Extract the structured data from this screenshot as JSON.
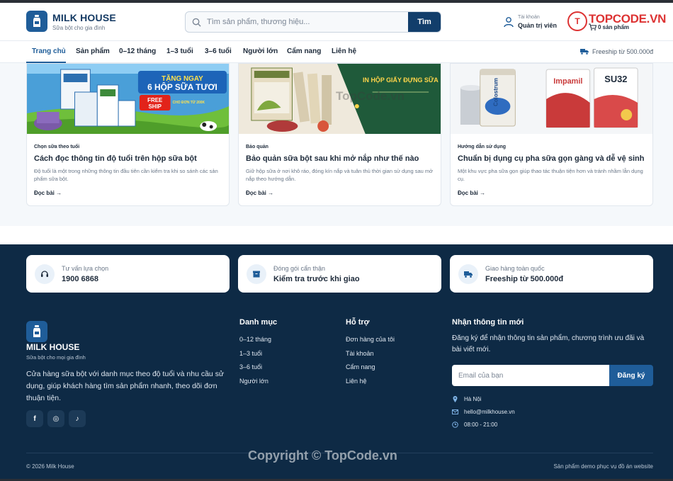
{
  "header": {
    "brand_name": "MILK HOUSE",
    "brand_tagline": "Sữa bột cho gia đình",
    "search_placeholder": "Tìm sản phẩm, thương hiệu...",
    "search_button": "Tìm",
    "account_small": "Tài khoản",
    "account_big": "Quản trị viên",
    "cart_count": "0 sản phẩm",
    "topcode_text": "TOPCODE.VN"
  },
  "nav": {
    "items": [
      {
        "label": "Trang chủ",
        "active": true
      },
      {
        "label": "Sản phẩm"
      },
      {
        "label": "0–12 tháng"
      },
      {
        "label": "1–3 tuổi"
      },
      {
        "label": "3–6 tuổi"
      },
      {
        "label": "Người lớn"
      },
      {
        "label": "Cẩm nang"
      },
      {
        "label": "Liên hệ"
      }
    ],
    "freeship": "Freeship từ 500.000đ"
  },
  "articles": [
    {
      "category": "Chọn sữa theo tuổi",
      "title": "Cách đọc thông tin độ tuổi trên hộp sữa bột",
      "description": "Độ tuổi là một trong những thông tin đầu tiên cần kiểm tra khi so sánh các sản phẩm sữa bột.",
      "link": "Đọc bài →",
      "image_text": {
        "promo1": "TẶNG NGAY",
        "promo2": "6 HỘP SỮA TƯƠI",
        "free1": "FREE",
        "free2": "SHIP",
        "min": "CHO ĐƠN TỪ 200K"
      }
    },
    {
      "category": "Bảo quản",
      "title": "Bảo quản sữa bột sau khi mở nắp như thế nào",
      "description": "Giữ hộp sữa ở nơi khô ráo, đóng kín nắp và tuân thủ thời gian sử dụng sau mở nắp theo hướng dẫn.",
      "link": "Đọc bài →",
      "image_text": {
        "headline": "IN HỘP GIẤY ĐỰNG SỮA"
      }
    },
    {
      "category": "Hướng dẫn sử dụng",
      "title": "Chuẩn bị dụng cụ pha sữa gọn gàng và dễ vệ sinh",
      "description": "Một khu vực pha sữa gọn giúp thao tác thuận tiện hơn và tránh nhầm lẫn dụng cụ.",
      "link": "Đọc bài →",
      "image_text": {
        "can1": "Colostrum",
        "can2": "Impamil",
        "can3": "SU32"
      }
    }
  ],
  "features": [
    {
      "small": "Tư vấn lựa chọn",
      "big": "1900 6868",
      "icon": "headset-icon"
    },
    {
      "small": "Đóng gói cẩn thận",
      "big": "Kiểm tra trước khi giao",
      "icon": "box-icon"
    },
    {
      "small": "Giao hàng toàn quốc",
      "big": "Freeship từ 500.000đ",
      "icon": "truck-icon"
    }
  ],
  "footer": {
    "brand_name": "MILK HOUSE",
    "brand_tagline": "Sữa bột cho mọi gia đình",
    "description": "Cửa hàng sữa bột với danh mục theo độ tuổi và nhu cầu sử dụng, giúp khách hàng tìm sản phẩm nhanh, theo dõi đơn thuận tiện.",
    "social": [
      {
        "label": "f",
        "icon": "facebook-icon"
      },
      {
        "label": "◎",
        "icon": "instagram-icon"
      },
      {
        "label": "♪",
        "icon": "tiktok-icon"
      }
    ],
    "categories_title": "Danh mục",
    "categories": [
      "0–12 tháng",
      "1–3 tuổi",
      "3–6 tuổi",
      "Người lớn"
    ],
    "support_title": "Hỗ trợ",
    "support": [
      "Đơn hàng của tôi",
      "Tài khoản",
      "Cẩm nang",
      "Liên hệ"
    ],
    "newsletter_title": "Nhận thông tin mới",
    "newsletter_desc": "Đăng ký để nhận thông tin sản phẩm, chương trình ưu đãi và bài viết mới.",
    "newsletter_placeholder": "Email của bạn",
    "newsletter_button": "Đăng ký",
    "contacts": [
      {
        "text": "Hà Nội",
        "icon": "location-icon"
      },
      {
        "text": "hello@milkhouse.vn",
        "icon": "mail-icon"
      },
      {
        "text": "08:00 - 21:00",
        "icon": "clock-icon"
      }
    ],
    "copyright": "© 2026 Milk House",
    "demo_note": "Sản phẩm demo phục vụ đồ án website"
  },
  "watermarks": {
    "mid": "TopCode.vn",
    "bottom": "Copyright © TopCode.vn"
  },
  "colors": {
    "primary": "#1f5d99",
    "dark_navy": "#0e2a45",
    "search_button": "#123e6b"
  }
}
